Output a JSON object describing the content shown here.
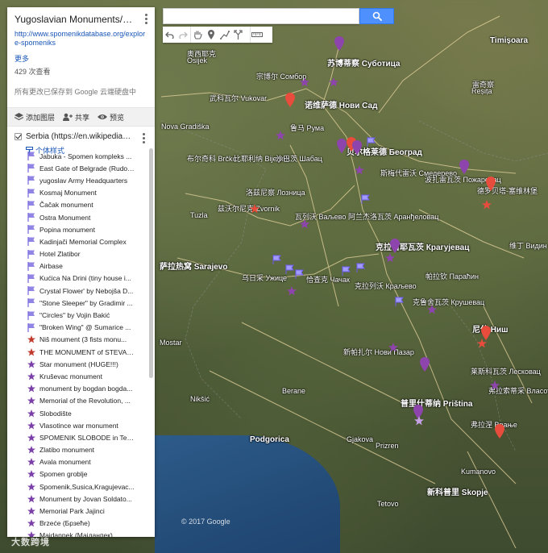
{
  "panel": {
    "title": "Yugoslavian Monuments/Soviet ...",
    "url": "http://www.spomenikdatabase.org/explore-spomeniks",
    "more": "更多",
    "views": "429 次查看",
    "saved": "所有更改已保存到 Google 云端硬盘中",
    "actions": {
      "add_layer": "添加图层",
      "share": "共享",
      "preview": "预览"
    },
    "layer": {
      "name": "Serbia (https://en.wikipedia.org/...",
      "style": "个体样式"
    },
    "items": [
      {
        "label": "Jabuka - Spomen kompleks ...",
        "icon": "flag",
        "color": "#7c6fe0"
      },
      {
        "label": "East Gate of Belgrade (Rudo ...",
        "icon": "flag",
        "color": "#7c6fe0"
      },
      {
        "label": "yugoslav Army Headquarters",
        "icon": "flag",
        "color": "#7c6fe0"
      },
      {
        "label": "Kosmaj Monument",
        "icon": "flag",
        "color": "#7c6fe0"
      },
      {
        "label": "Čačak monument",
        "icon": "flag",
        "color": "#7c6fe0"
      },
      {
        "label": "Ostra Monument",
        "icon": "flag",
        "color": "#7c6fe0"
      },
      {
        "label": "Popina monument",
        "icon": "flag",
        "color": "#7c6fe0"
      },
      {
        "label": "Kadinjači Memorial Complex",
        "icon": "flag",
        "color": "#7c6fe0"
      },
      {
        "label": "Hotel Zlatibor",
        "icon": "flag",
        "color": "#7c6fe0"
      },
      {
        "label": "Airbase",
        "icon": "flag",
        "color": "#7c6fe0"
      },
      {
        "label": "Kućica Na Drini (tiny house i...",
        "icon": "flag",
        "color": "#7c6fe0"
      },
      {
        "label": "Crystal Flower' by Nebojša D...",
        "icon": "flag",
        "color": "#7c6fe0"
      },
      {
        "label": "\"Stone Sleeper\" by Gradimir ...",
        "icon": "flag",
        "color": "#7c6fe0"
      },
      {
        "label": "\"Circles\" by Vojin Bakić",
        "icon": "flag",
        "color": "#7c6fe0"
      },
      {
        "label": "\"Broken Wing\" @ Sumarice ...",
        "icon": "flag",
        "color": "#7c6fe0"
      },
      {
        "label": "Niš moument (3 fists monu...",
        "icon": "star",
        "color": "#c0392b"
      },
      {
        "label": "THE MONUMENT of STEVAN...",
        "icon": "star",
        "color": "#c0392b"
      },
      {
        "label": "Star monument (HUGE!!!)",
        "icon": "star",
        "color": "#7b3fa8"
      },
      {
        "label": "Kruševac monument",
        "icon": "star",
        "color": "#7b3fa8"
      },
      {
        "label": "monument by bogdan bogda...",
        "icon": "star",
        "color": "#7b3fa8"
      },
      {
        "label": "Memorial of the Revolution, ...",
        "icon": "star",
        "color": "#7b3fa8"
      },
      {
        "label": "Slobodište",
        "icon": "star",
        "color": "#7b3fa8"
      },
      {
        "label": "Vlasotince war monument",
        "icon": "star",
        "color": "#7b3fa8"
      },
      {
        "label": "SPOMENIK SLOBODE in Tem...",
        "icon": "star",
        "color": "#7b3fa8"
      },
      {
        "label": "Zlatibo monument",
        "icon": "star",
        "color": "#7b3fa8"
      },
      {
        "label": "Avala monument",
        "icon": "star",
        "color": "#7b3fa8"
      },
      {
        "label": "Spomen groblje",
        "icon": "star",
        "color": "#7b3fa8"
      },
      {
        "label": "Spomenik,Susica,Kragujevac...",
        "icon": "star",
        "color": "#7b3fa8"
      },
      {
        "label": "Monument by Jovan Soldato...",
        "icon": "star",
        "color": "#7b3fa8"
      },
      {
        "label": "Memorial Park Jajinci",
        "icon": "star",
        "color": "#7b3fa8"
      },
      {
        "label": "Brzeće (Брзеће)",
        "icon": "star",
        "color": "#7b3fa8"
      },
      {
        "label": "Majdanpek (Мајданпек)",
        "icon": "star",
        "color": "#7b3fa8"
      }
    ]
  },
  "search": {
    "value": "",
    "placeholder": ""
  },
  "map": {
    "attribution": "© 2017 Google",
    "labels": [
      {
        "text": "Timișoara",
        "bold": true
      },
      {
        "text": "奥西耶克"
      },
      {
        "text": "Osijek"
      },
      {
        "text": "苏博蒂察 Суботица",
        "bold": true
      },
      {
        "text": "宗博尔 Сомбор"
      },
      {
        "text": "诺维萨德 Нови Сад",
        "bold": true
      },
      {
        "text": "武科瓦尔 Vukovar"
      },
      {
        "text": "鲁马 Рума"
      },
      {
        "text": "布尔奇科 Brčko"
      },
      {
        "text": "比耶利纳 Bijeljina"
      },
      {
        "text": "沙巴茨 Шабац"
      },
      {
        "text": "贝尔格莱德 Београд",
        "bold": true
      },
      {
        "text": "斯梅代雷沃 Смедерево"
      },
      {
        "text": "波扎雷瓦茨 Пожаревац"
      },
      {
        "text": "洛兹尼察 Лозница"
      },
      {
        "text": "兹沃尔尼克 Zvornik"
      },
      {
        "text": "瓦列沃 Ваљево"
      },
      {
        "text": "阿兰杰洛瓦茨 Аранђеловац"
      },
      {
        "text": "萨拉热窝 Sarajevo",
        "bold": true
      },
      {
        "text": "乌日采 Ужице"
      },
      {
        "text": "恰查克 Чачак"
      },
      {
        "text": "克拉古耶瓦茨 Крагујевац",
        "bold": true
      },
      {
        "text": "克拉列沃 Краљево"
      },
      {
        "text": "克鲁舍瓦茨 Крушевац"
      },
      {
        "text": "帕拉钦 Параћин"
      },
      {
        "text": "尼什 Ниш",
        "bold": true
      },
      {
        "text": "新帕扎尔 Нови Пазар"
      },
      {
        "text": "莱斯科瓦茨 Лесковац"
      },
      {
        "text": "弗拉索蒂采 Власотинце"
      },
      {
        "text": "普里什蒂纳 Priština",
        "bold": true
      },
      {
        "text": "弗拉涅 Врање"
      },
      {
        "text": "Podgorica",
        "bold": true
      },
      {
        "text": "新科普里 Skopje",
        "bold": true
      },
      {
        "text": "德罗贝塔-塞维林堡"
      },
      {
        "text": "维丁 Видин"
      },
      {
        "text": "Reșița"
      },
      {
        "text": "雷奇察"
      },
      {
        "text": "Berane"
      },
      {
        "text": "Gjakova"
      },
      {
        "text": "Prizren"
      },
      {
        "text": "Kumanovo"
      },
      {
        "text": "Tetovo"
      },
      {
        "text": "Nikšić"
      },
      {
        "text": "Mostar"
      },
      {
        "text": "Tuzla"
      },
      {
        "text": "Nova Gradiška"
      }
    ]
  },
  "watermark": "大数跨境"
}
